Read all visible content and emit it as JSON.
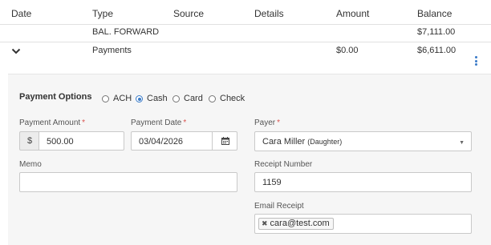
{
  "table": {
    "headers": [
      "Date",
      "Type",
      "Source",
      "Details",
      "Amount",
      "Balance"
    ],
    "rows": [
      {
        "type": "BAL. FORWARD",
        "amount": "",
        "balance": "$7,111.00"
      },
      {
        "type": "Payments",
        "amount": "$0.00",
        "balance": "$6,611.00"
      }
    ]
  },
  "payment": {
    "title": "Payment Options",
    "options": [
      "ACH",
      "Cash",
      "Card",
      "Check"
    ],
    "selected": "Cash",
    "amount_label": "Payment Amount",
    "currency_symbol": "$",
    "amount_value": "500.00",
    "date_label": "Payment Date",
    "date_value": "03/04/2026",
    "payer_label": "Payer",
    "payer_name": "Cara Miller",
    "payer_relation": "(Daughter)",
    "memo_label": "Memo",
    "memo_value": "",
    "receipt_label": "Receipt Number",
    "receipt_value": "1159",
    "email_label": "Email Receipt",
    "email_tag": "cara@test.com",
    "required_mark": "*"
  },
  "icons": {
    "expand": "chevron-down-icon",
    "menu": "kebab-menu-icon",
    "calendar": "calendar-icon",
    "dropdown": "caret-down-icon",
    "remove": "close-icon"
  },
  "colors": {
    "accent": "#3a7bc8",
    "required": "#d9534f",
    "panel_bg": "#f6f6f6"
  }
}
